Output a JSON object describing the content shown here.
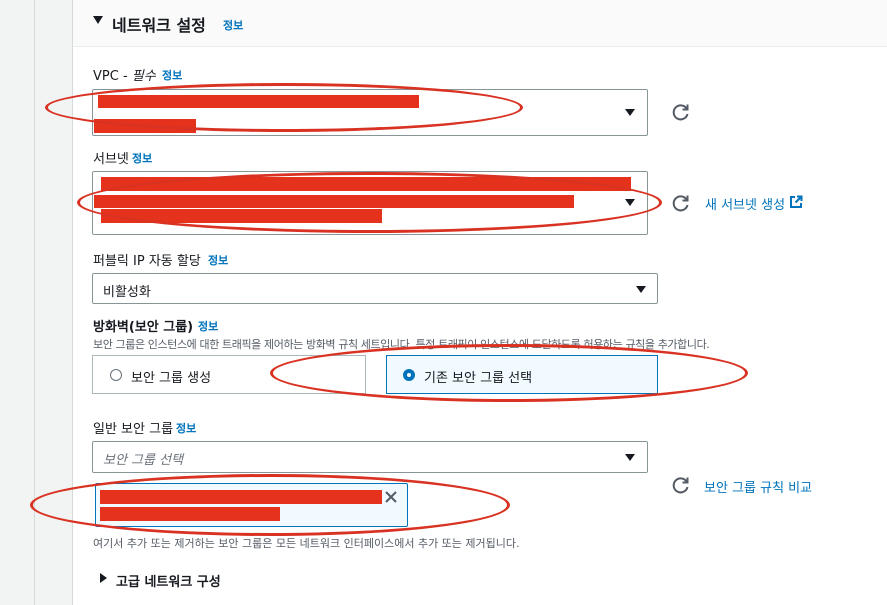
{
  "section": {
    "title": "네트워크 설정",
    "info": "정보"
  },
  "vpc": {
    "label": "VPC - ",
    "required": "필수",
    "info": "정보"
  },
  "subnet": {
    "label": "서브넷",
    "info": "정보",
    "create_link": "새 서브넷 생성"
  },
  "public_ip": {
    "label": "퍼블릭 IP 자동 할당",
    "info": "정보",
    "value": "비활성화"
  },
  "firewall": {
    "label": "방화벽(보안 그룹)",
    "info": "정보",
    "description": "보안 그룹은 인스턴스에 대한 트래픽을 제어하는 방화벽 규칙 세트입니다. 특정 트래픽이 인스턴스에 도달하도록 허용하는 규칙을 추가합니다.",
    "option_create": "보안 그룹 생성",
    "option_existing": "기존 보안 그룹 선택"
  },
  "sg": {
    "label": "일반 보안 그룹",
    "info": "정보",
    "placeholder": "보안 그룹 선택",
    "compare_link": "보안 그룹 규칙 비교",
    "note": "여기서 추가 또는 제거하는 보안 그룹은 모든 네트워크 인터페이스에서 추가 또는 제거됩니다."
  },
  "advanced": {
    "label": "고급 네트워크 구성"
  },
  "colors": {
    "accent": "#0073bb",
    "annotation": "#d93222",
    "redaction": "#e4321c"
  }
}
